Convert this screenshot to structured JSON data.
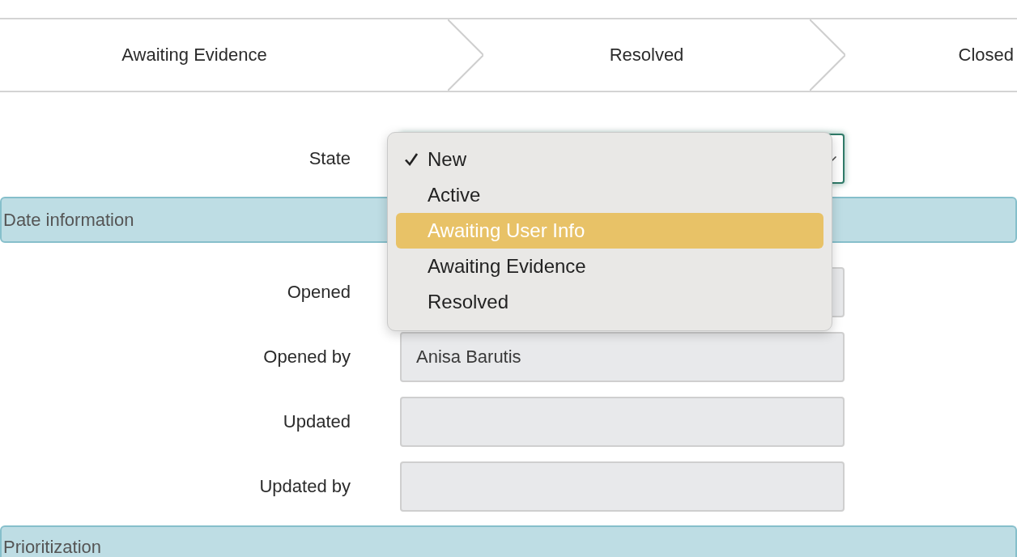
{
  "stages": [
    {
      "label": "Awaiting Evidence"
    },
    {
      "label": "Resolved"
    },
    {
      "label": "Closed"
    }
  ],
  "state_field": {
    "label": "State",
    "focused": true
  },
  "state_dropdown": [
    {
      "label": "New",
      "selected": true,
      "highlighted": false
    },
    {
      "label": "Active",
      "selected": false,
      "highlighted": false
    },
    {
      "label": "Awaiting User Info",
      "selected": false,
      "highlighted": true
    },
    {
      "label": "Awaiting Evidence",
      "selected": false,
      "highlighted": false
    },
    {
      "label": "Resolved",
      "selected": false,
      "highlighted": false
    }
  ],
  "sections": [
    {
      "title": "Date information",
      "fields": [
        {
          "label": "Opened"
        },
        {
          "label": "Opened by",
          "value": "Anisa Barutis"
        },
        {
          "label": "Updated"
        },
        {
          "label": "Updated by"
        }
      ]
    },
    {
      "title": "Prioritization"
    }
  ]
}
